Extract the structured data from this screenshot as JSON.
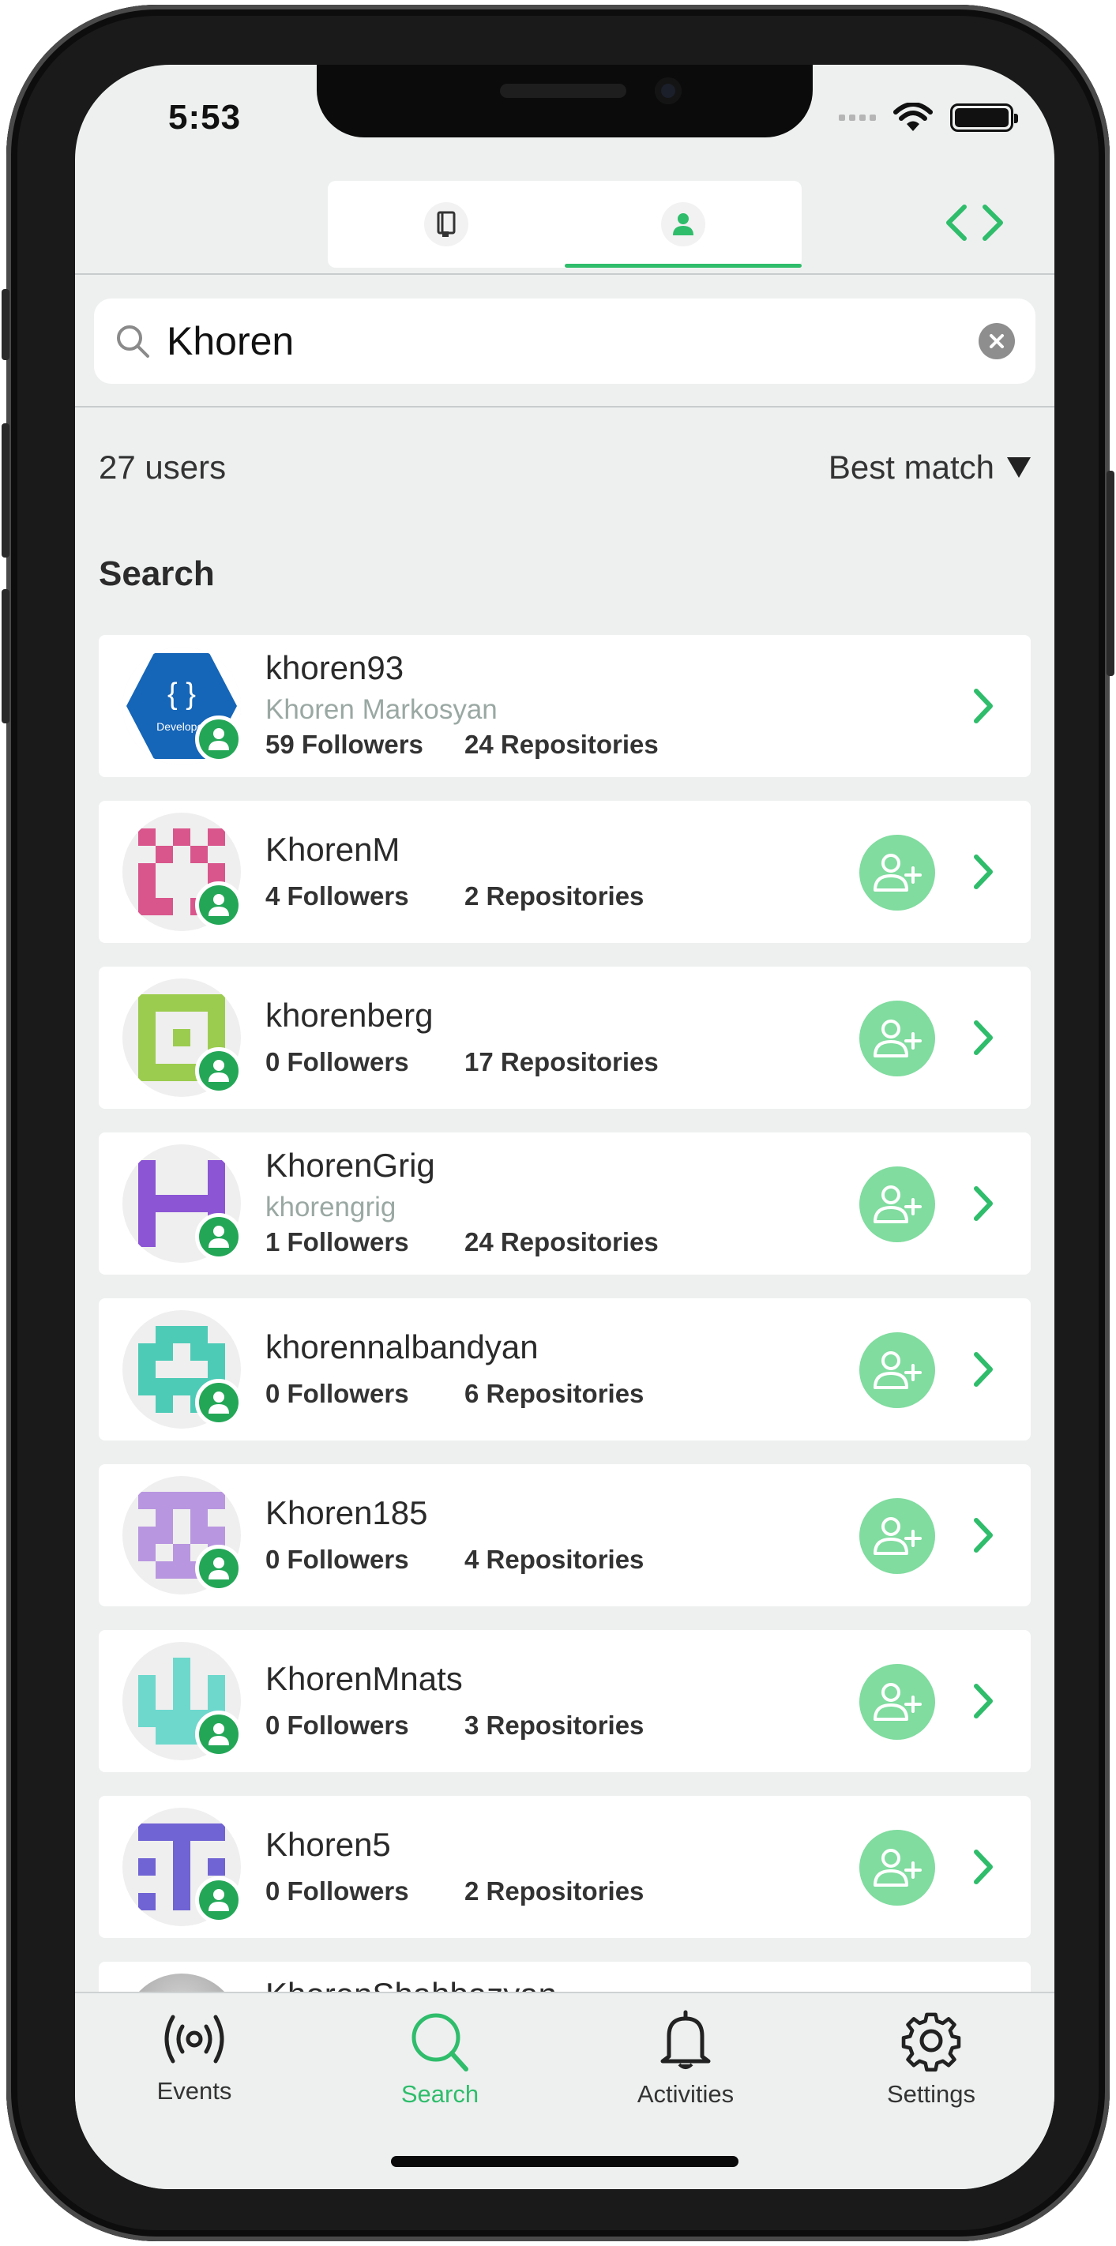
{
  "status_bar": {
    "time": "5:53"
  },
  "top_tabs": [
    {
      "icon": "repository-book-icon",
      "active": false
    },
    {
      "icon": "user-person-icon",
      "active": true
    }
  ],
  "code_icon": "code-brackets-icon",
  "search": {
    "value": "Khoren",
    "clear_icon": "clear-x-icon"
  },
  "results": {
    "count_label": "27 users",
    "sort_label": "Best match"
  },
  "section_title": "Search",
  "users": [
    {
      "login": "khoren93",
      "name": "Khoren Markosyan",
      "followers": "59 Followers",
      "repos": "24 Repositories",
      "follow_button": false,
      "avatar_color": "#1565b8"
    },
    {
      "login": "KhorenM",
      "name": "",
      "followers": "4 Followers",
      "repos": "2 Repositories",
      "follow_button": true,
      "avatar_color": "#d9568c"
    },
    {
      "login": "khorenberg",
      "name": "",
      "followers": "0 Followers",
      "repos": "17 Repositories",
      "follow_button": true,
      "avatar_color": "#9ccc4f"
    },
    {
      "login": "KhorenGrig",
      "name": "khorengrig",
      "followers": "1 Followers",
      "repos": "24 Repositories",
      "follow_button": true,
      "avatar_color": "#8b55d4"
    },
    {
      "login": "khorennalbandyan",
      "name": "",
      "followers": "0 Followers",
      "repos": "6 Repositories",
      "follow_button": true,
      "avatar_color": "#4dcbb7"
    },
    {
      "login": "Khoren185",
      "name": "",
      "followers": "0 Followers",
      "repos": "4 Repositories",
      "follow_button": true,
      "avatar_color": "#b996e0"
    },
    {
      "login": "KhorenMnats",
      "name": "",
      "followers": "0 Followers",
      "repos": "3 Repositories",
      "follow_button": true,
      "avatar_color": "#6ed8cd"
    },
    {
      "login": "Khoren5",
      "name": "",
      "followers": "0 Followers",
      "repos": "2 Repositories",
      "follow_button": true,
      "avatar_color": "#7063d3"
    }
  ],
  "partial_user": {
    "login": "KhorenShahbazyan"
  },
  "tabbar": [
    {
      "label": "Events",
      "icon": "broadcast-icon",
      "active": false
    },
    {
      "label": "Search",
      "icon": "search-icon",
      "active": true
    },
    {
      "label": "Activities",
      "icon": "bell-icon",
      "active": false
    },
    {
      "label": "Settings",
      "icon": "gear-icon",
      "active": false
    }
  ],
  "colors": {
    "accent": "#2fbd6b",
    "follow_button": "#80dc9f",
    "badge": "#23a757",
    "background": "#eef0f0"
  }
}
